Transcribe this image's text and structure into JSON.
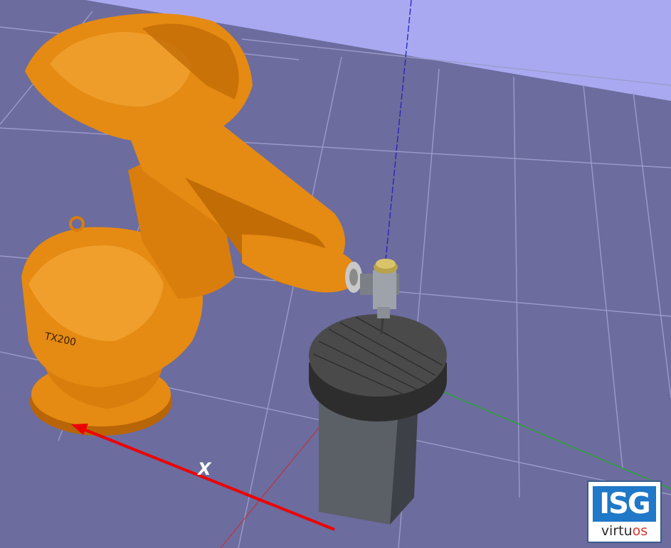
{
  "viewport": {
    "floor_color": "#6c6c9e",
    "background_color": "#a9a9f2",
    "grid_line_color": "#9a9ac9"
  },
  "robot": {
    "model_label": "TX200",
    "body_color": "#e58a12"
  },
  "axis": {
    "x_label": "X",
    "x_color": "#ee0000",
    "y_color": "#22aa22",
    "z_color": "#2222bb"
  },
  "workpiece": {
    "table_color": "#4a4a4a",
    "pedestal_color": "#5b5f66"
  },
  "logo": {
    "brand_mark": "ISG",
    "word_before": "virtu",
    "word_accent": "os",
    "brand_color": "#1f78c8",
    "accent_color": "#e0312d"
  }
}
